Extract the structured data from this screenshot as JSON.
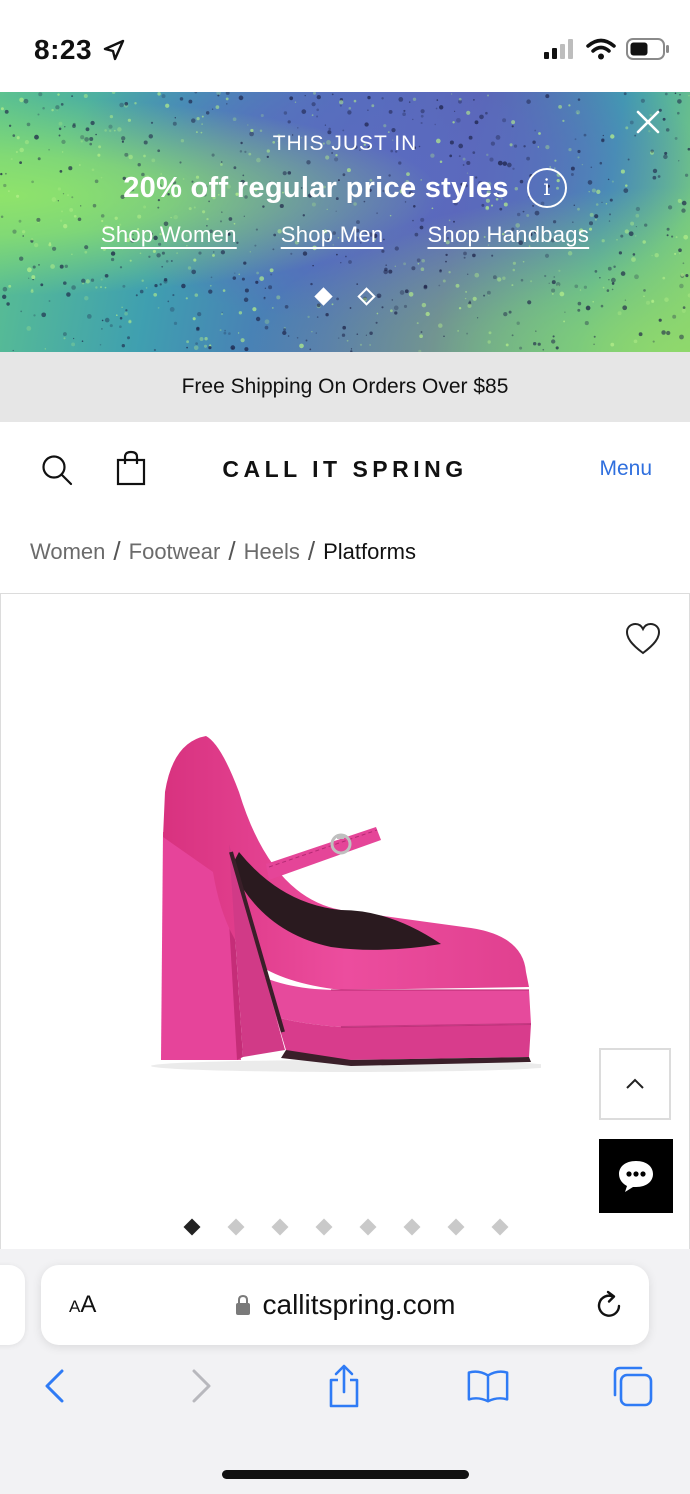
{
  "status_bar": {
    "time": "8:23"
  },
  "promo": {
    "eyebrow": "THIS JUST IN",
    "title": "20% off regular price styles",
    "info_glyph": "i",
    "links": [
      "Shop Women",
      "Shop Men",
      "Shop Handbags"
    ],
    "slide_count": 2,
    "active_slide": 1
  },
  "shipping_bar": {
    "text": "Free Shipping On Orders Over $85"
  },
  "header": {
    "logo": "CALL IT SPRING",
    "menu_label": "Menu"
  },
  "breadcrumb": {
    "items": [
      "Women",
      "Footwear",
      "Heels"
    ],
    "separator": "/",
    "current": "Platforms"
  },
  "product": {
    "image_count": 8,
    "active_image": 1,
    "shoe_color": "#e8489a"
  },
  "browser": {
    "aa_label_small": "A",
    "aa_label_large": "A",
    "url": "callitspring.com"
  },
  "colors": {
    "menu_link": "#2f6fde",
    "safari_blue": "#2f7bf5",
    "shipping_bg": "#e6e6e6"
  }
}
